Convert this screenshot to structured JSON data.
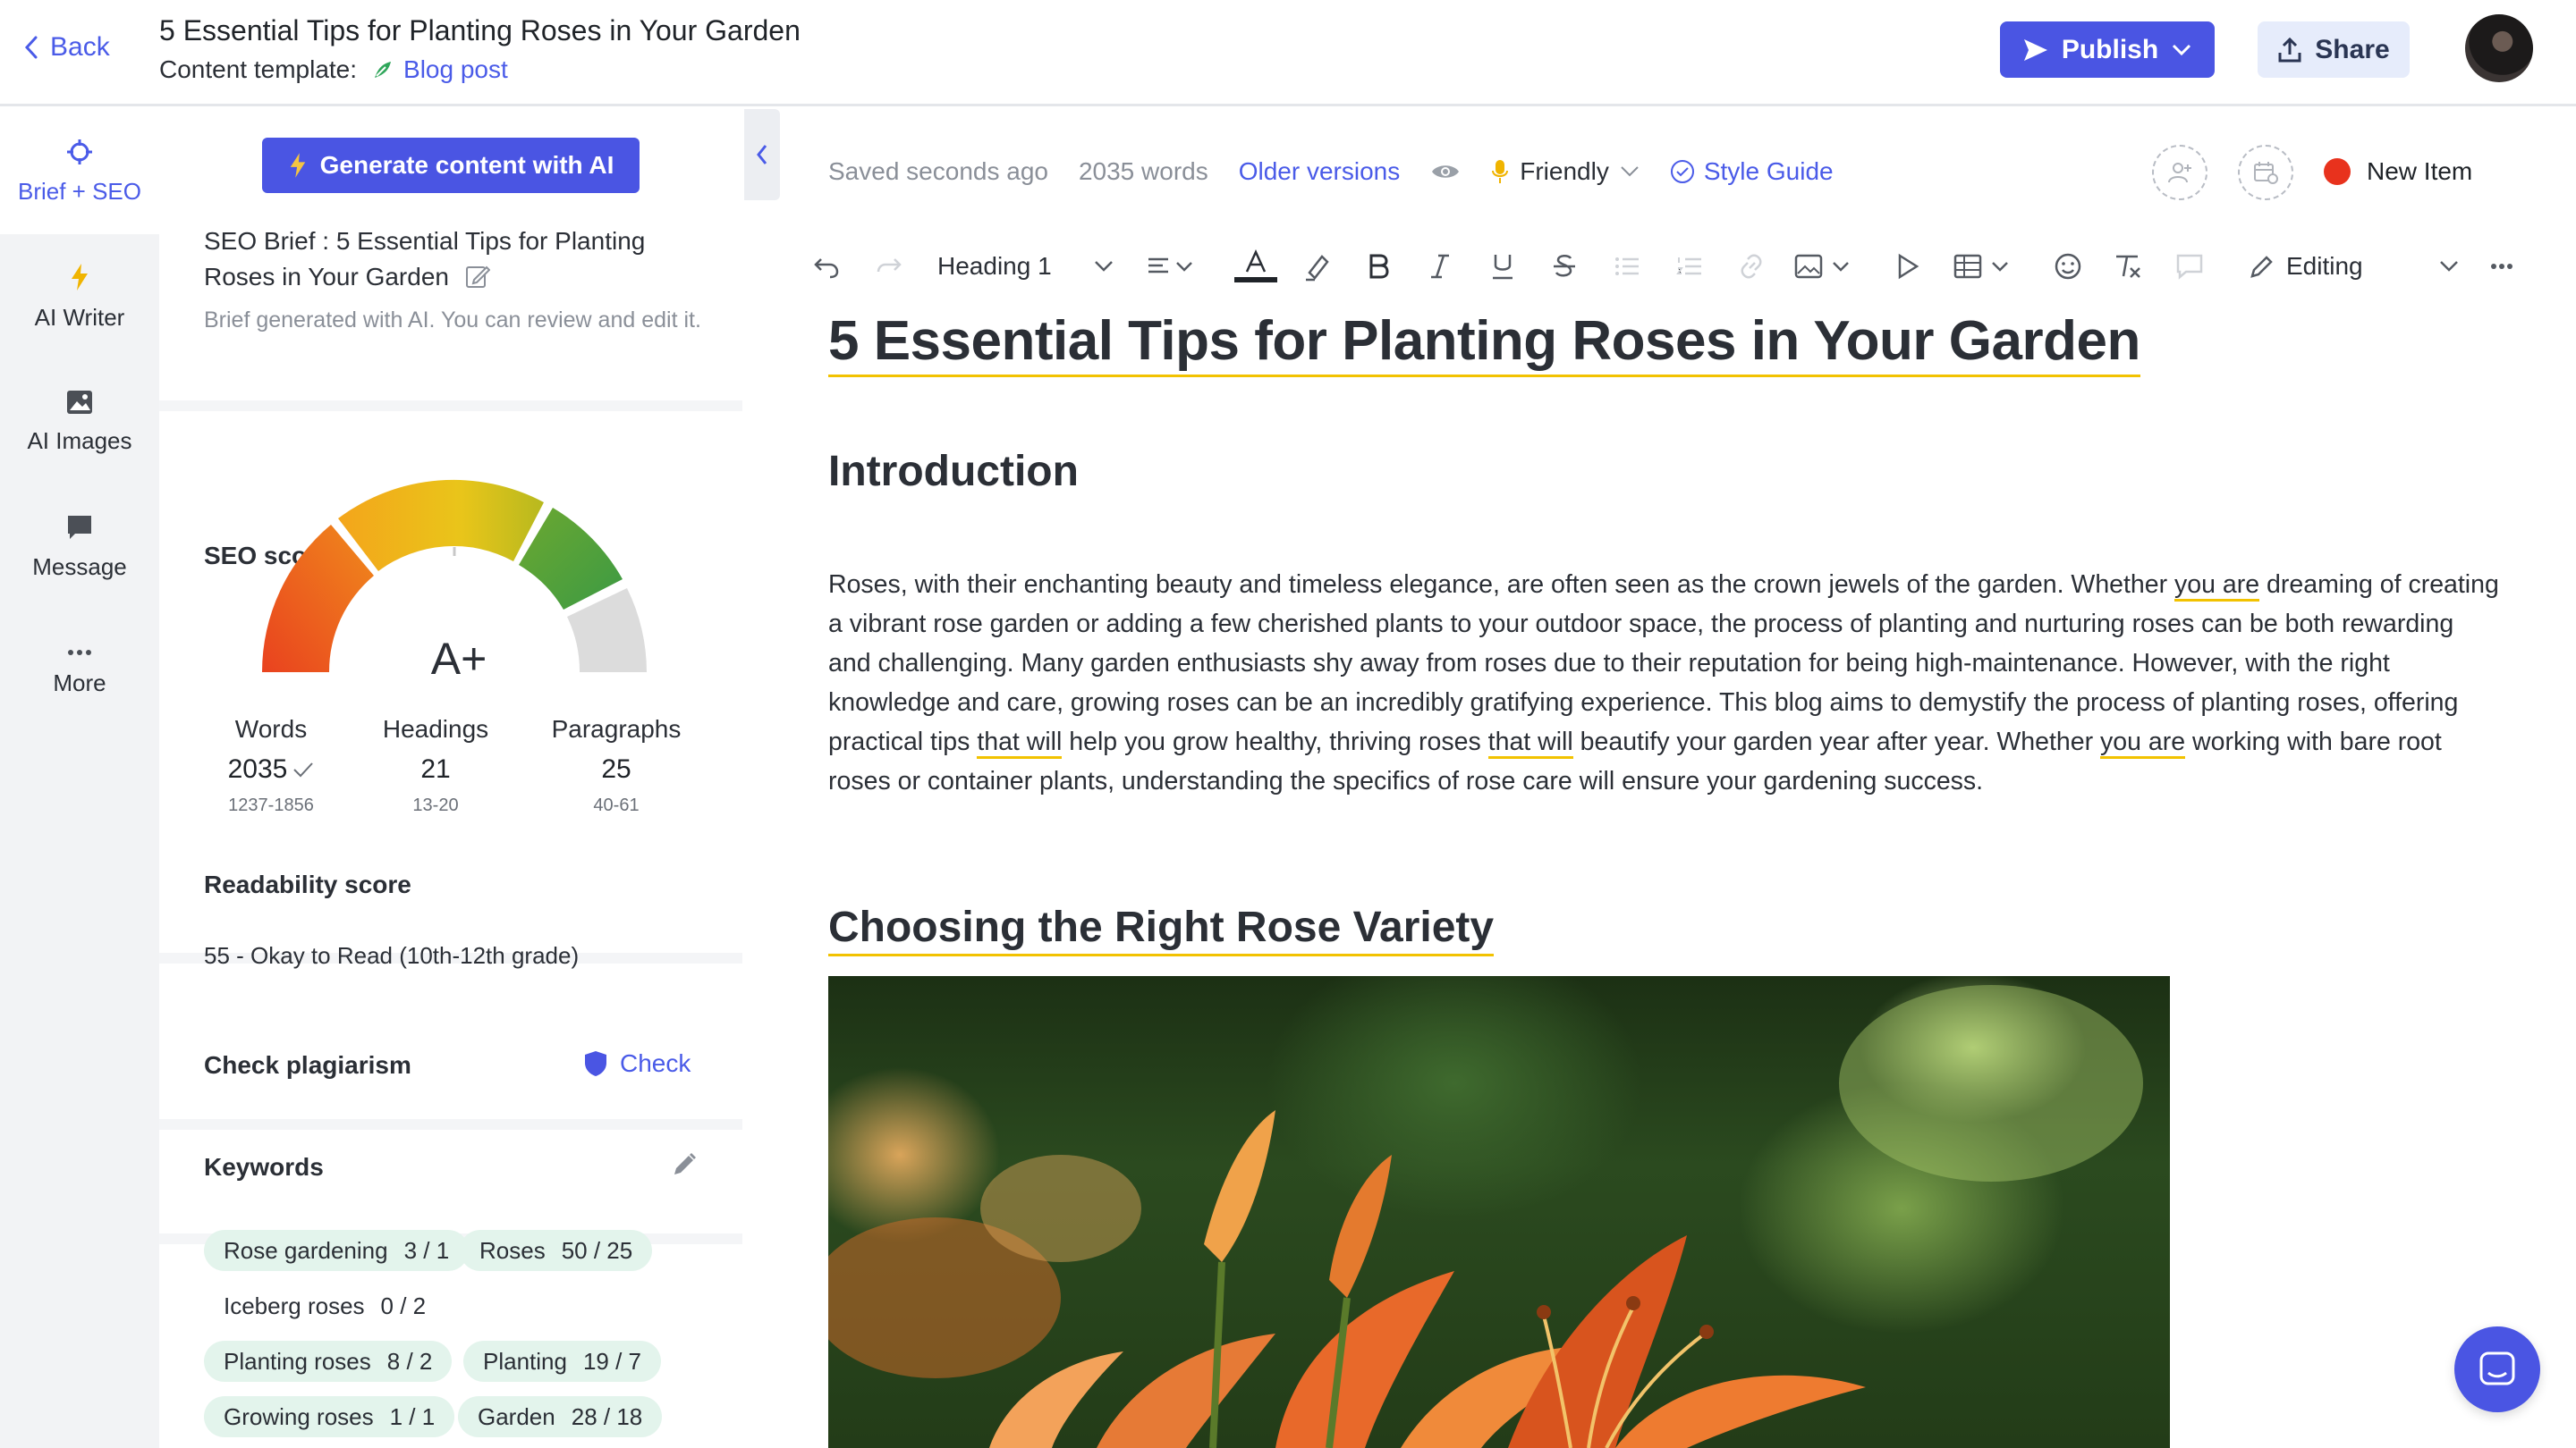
{
  "header": {
    "back_label": "Back",
    "doc_title": "5 Essential Tips for Planting Roses in Your Garden",
    "template_label": "Content template:",
    "template_value": "Blog post",
    "publish_label": "Publish",
    "share_label": "Share"
  },
  "nav": {
    "items": [
      {
        "label": "Brief + SEO",
        "icon": "crosshair-icon"
      },
      {
        "label": "AI Writer",
        "icon": "bolt-icon"
      },
      {
        "label": "AI Images",
        "icon": "image-icon"
      },
      {
        "label": "Message",
        "icon": "chat-icon"
      },
      {
        "label": "More",
        "icon": "more-icon"
      }
    ]
  },
  "brief": {
    "generate_label": "Generate content with AI",
    "title": "SEO Brief : 5 Essential Tips for Planting Roses in Your Garden",
    "subtitle": "Brief generated with AI. You can review and edit it.",
    "seo_heading": "SEO score",
    "grade": "A+",
    "stats": [
      {
        "label": "Words",
        "value": "2035",
        "range": "1237-1856"
      },
      {
        "label": "Headings",
        "value": "21",
        "range": "13-20"
      },
      {
        "label": "Paragraphs",
        "value": "25",
        "range": "40-61"
      }
    ],
    "readability_heading": "Readability score",
    "readability_value": "55 - Okay to Read (10th-12th grade)",
    "plagiarism_heading": "Check plagiarism",
    "check_label": "Check",
    "keywords_heading": "Keywords",
    "keywords": [
      {
        "name": "Rose gardening",
        "count": "3 / 1"
      },
      {
        "name": "Roses",
        "count": "50 / 25"
      },
      {
        "name": "Iceberg roses",
        "count": "0 / 2"
      },
      {
        "name": "Planting roses",
        "count": "8 / 2"
      },
      {
        "name": "Planting",
        "count": "19 / 7"
      },
      {
        "name": "Growing roses",
        "count": "1 / 1"
      },
      {
        "name": "Garden",
        "count": "28 / 18"
      }
    ]
  },
  "editor": {
    "saved": "Saved seconds ago",
    "words": "2035 words",
    "older_versions": "Older versions",
    "tone": "Friendly",
    "style_guide": "Style Guide",
    "new_item": "New Item",
    "block_type": "Heading 1",
    "mode": "Editing"
  },
  "article": {
    "h1": "5 Essential Tips for Planting Roses in Your Garden",
    "intro_heading": "Introduction",
    "para_parts": [
      "Roses, with their enchanting beauty and timeless elegance, are often seen as the crown jewels of the garden. Whether ",
      "you are",
      " dreaming of creating a vibrant rose garden or adding a few cherished plants to your outdoor space, the process of planting and nurturing roses can be both rewarding and challenging. Many garden enthusiasts shy away from roses due to their reputation for being high-maintenance. However, with the right knowledge and care, growing roses can be an incredibly gratifying experience. This blog aims to demystify the process of planting roses, offering practical tips ",
      "that will",
      " help you grow healthy, thriving roses ",
      "that will",
      " beautify your garden year after year. Whether ",
      "you are",
      " working with bare root roses or container plants, understanding the specifics of rose care will ensure your gardening success."
    ],
    "section_heading": "Choosing the Right Rose Variety"
  },
  "colors": {
    "accent": "#4a55e3",
    "highlight": "#f2c200",
    "keyword_chip": "#e3f4ec",
    "status_dot": "#e8321d"
  }
}
